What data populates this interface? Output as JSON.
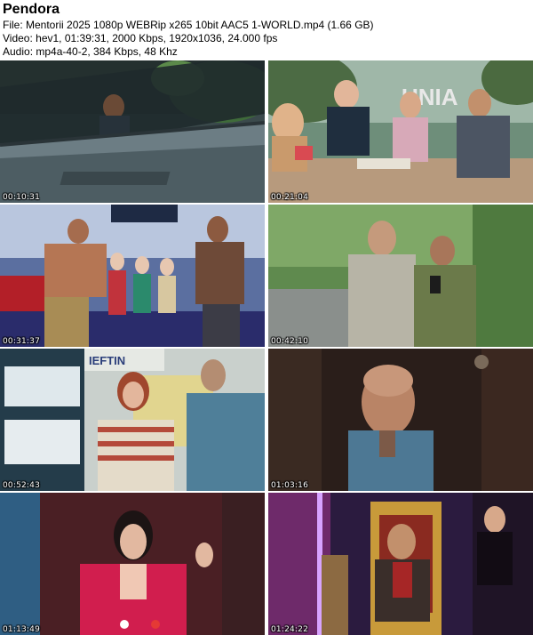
{
  "header": {
    "title": "Pendora",
    "file_line": "File: Mentorii 2025 1080p WEBRip x265 10bit AAC5 1-WORLD.mp4 (1.66 GB)",
    "video_line": "Video: hev1, 01:39:31, 2000 Kbps, 1920x1036, 24.000 fps",
    "audio_line": "Audio: mp4a-40-2, 384 Kbps, 48 Khz"
  },
  "thumbnails": [
    {
      "timestamp": "00:10:31",
      "sign_text": ""
    },
    {
      "timestamp": "00:21:04",
      "sign_text": "UNIA"
    },
    {
      "timestamp": "00:31:37",
      "sign_text": ""
    },
    {
      "timestamp": "00:42:10",
      "sign_text": ""
    },
    {
      "timestamp": "00:52:43",
      "sign_text": "IEFTIN"
    },
    {
      "timestamp": "01:03:16",
      "sign_text": ""
    },
    {
      "timestamp": "01:13:49",
      "sign_text": ""
    },
    {
      "timestamp": "01:24:22",
      "sign_text": ""
    }
  ]
}
